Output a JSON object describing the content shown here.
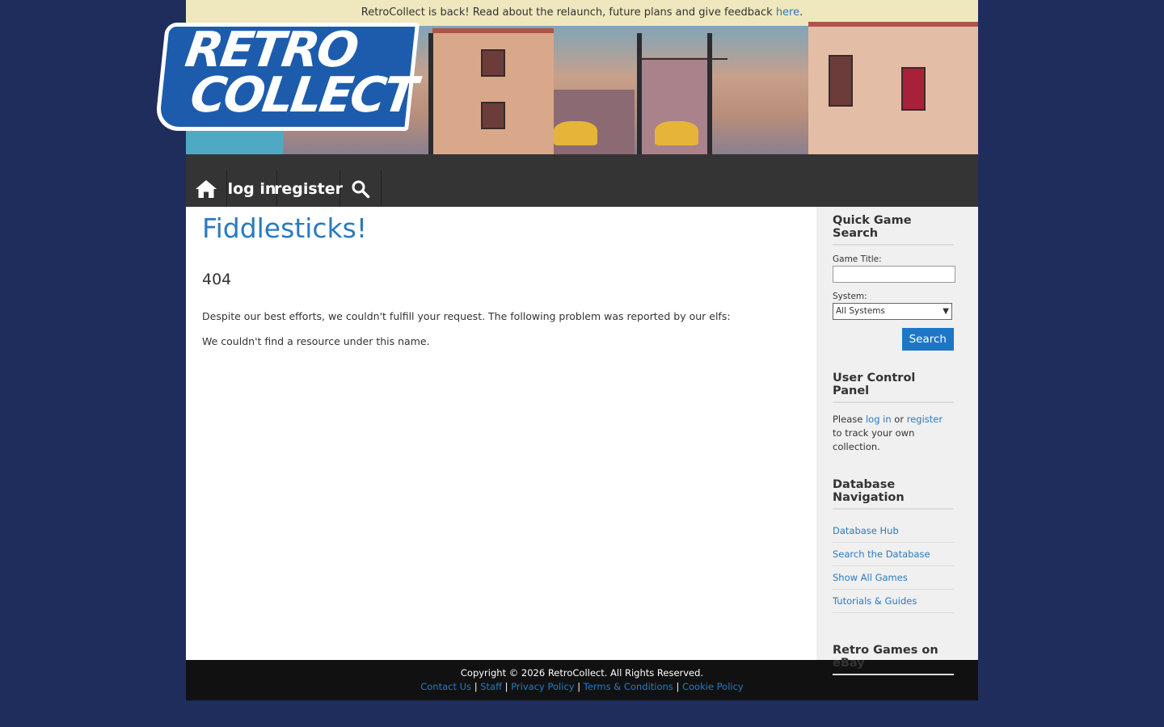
{
  "notice": {
    "text": "RetroCollect is back! Read about the relaunch, future plans and give feedback ",
    "link_label": "here",
    "suffix": "."
  },
  "logo": {
    "line1": "RETRO",
    "line2": "COLLECT"
  },
  "nav": {
    "home_icon": "home-icon",
    "login_label": "log in",
    "register_label": "register",
    "search_icon": "search-icon"
  },
  "content": {
    "title": "Fiddlesticks!",
    "code": "404",
    "message1": "Despite our best efforts, we couldn't fulfill your request. The following problem was reported by our elfs:",
    "message2": "We couldn't find a resource under this name."
  },
  "sidebar": {
    "quick_search": {
      "heading": "Quick Game Search",
      "title_label": "Game Title:",
      "title_value": "",
      "system_label": "System:",
      "system_selected": "All Systems",
      "button_label": "Search"
    },
    "user_panel": {
      "heading": "User Control Panel",
      "text_before": "Please ",
      "login_link": "log in",
      "text_mid": " or ",
      "register_link": "register",
      "text_after": " to track your own collection."
    },
    "db_nav": {
      "heading": "Database Navigation",
      "items": [
        "Database Hub",
        "Search the Database",
        "Show All Games",
        "Tutorials & Guides"
      ]
    },
    "ebay": {
      "heading": "Retro Games on eBay"
    }
  },
  "footer": {
    "copyright": "Copyright © 2026 RetroCollect. All Rights Reserved.",
    "links": [
      "Contact Us",
      "Staff",
      "Privacy Policy",
      "Terms & Conditions",
      "Cookie Policy"
    ],
    "separator": "|"
  },
  "colors": {
    "background": "#1f2d5c",
    "accent": "#2a7ac0",
    "button": "#1e76c7",
    "nav": "#343434",
    "notice": "#efe7bd"
  }
}
